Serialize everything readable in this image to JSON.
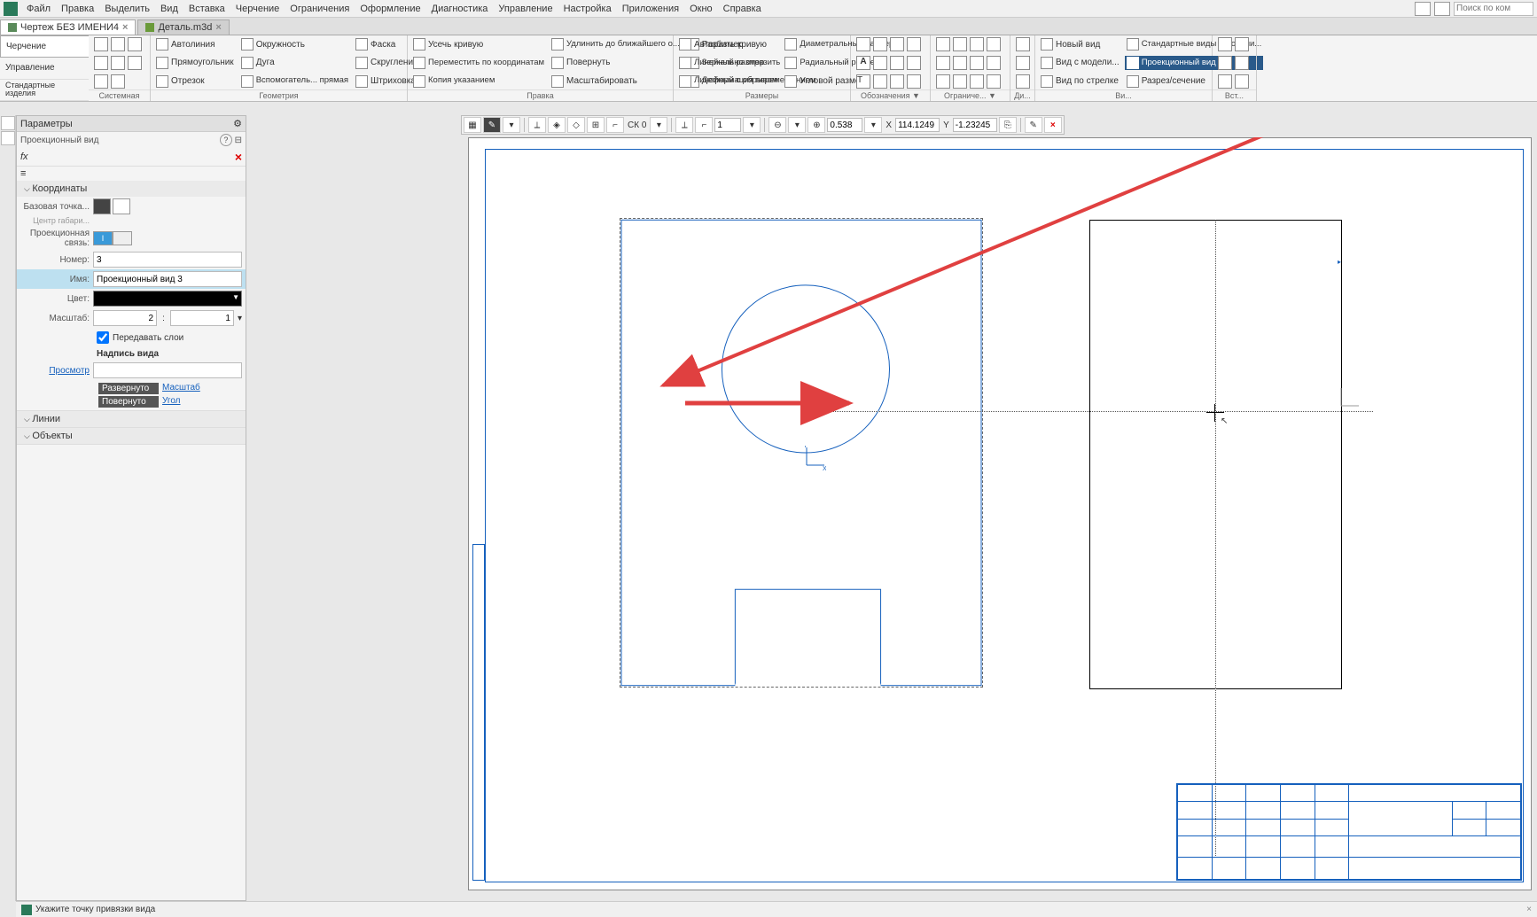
{
  "menu": [
    "Файл",
    "Правка",
    "Выделить",
    "Вид",
    "Вставка",
    "Черчение",
    "Ограничения",
    "Оформление",
    "Диагностика",
    "Управление",
    "Настройка",
    "Приложения",
    "Окно",
    "Справка"
  ],
  "search_placeholder": "Поиск по ком",
  "tabs": [
    {
      "label": "Чертеж БЕЗ ИМЕНИ4",
      "active": true
    },
    {
      "label": "Деталь.m3d",
      "active": false
    }
  ],
  "ribbon_left_tabs": [
    "Черчение",
    "Управление",
    "Стандартные изделия"
  ],
  "ribbon_groups": {
    "system": "Системная",
    "geometry": {
      "title": "Геометрия",
      "items": [
        "Автолиния",
        "Окружность",
        "Фаска",
        "Прямоугольник",
        "Дуга",
        "Скругление",
        "Отрезок",
        "Вспомогатель... прямая",
        "Штриховка"
      ]
    },
    "edit": {
      "title": "Правка",
      "items": [
        "Усечь кривую",
        "Удлинить до ближайшего о...",
        "Разбить кривую",
        "Переместить по координатам",
        "Повернуть",
        "Зеркально отразить",
        "Копия указанием",
        "Масштабировать",
        "Деформация перемещением"
      ]
    },
    "dims": {
      "title": "Размеры",
      "items": [
        "Авторазмер",
        "Диаметральный размер",
        "Линейный размер",
        "Радиальный размер",
        "Линейный с обрывом",
        "Угловой размер"
      ]
    },
    "annot": {
      "title": "Обозначения ▼"
    },
    "constraints": {
      "title": "Ограниче... ▼"
    },
    "diag": {
      "title": "Ди..."
    },
    "views": {
      "title": "Ви...",
      "items": [
        "Новый вид",
        "Стандартные виды с модели...",
        "Вид с модели...",
        "Проекционный вид",
        "Вид по стрелке",
        "Разрез/сечение"
      ]
    },
    "ins": {
      "title": "Вст..."
    }
  },
  "highlighted_button": "Проекционный вид",
  "drawing_toolbar": {
    "sk": "СК 0",
    "step": "1",
    "zoom": "0.538",
    "x_label": "X",
    "x": "114.1249",
    "y_label": "Y",
    "y": "-1.23245"
  },
  "panel": {
    "title": "Параметры",
    "subtitle": "Проекционный вид",
    "section_coords": "Координаты",
    "base_point_label": "Базовая точка...",
    "base_point_sub": "Центр габари...",
    "proj_link_label": "Проекционная связь:",
    "proj_link_on": "I",
    "number_label": "Номер:",
    "number": "3",
    "name_label": "Имя:",
    "name": "Проекционный вид 3",
    "color_label": "Цвет:",
    "scale_label": "Масштаб:",
    "scale_a": "2",
    "scale_b": "1",
    "layers_chk": "Передавать слои",
    "caption_header": "Надпись вида",
    "preview_label": "Просмотр",
    "grid_rows": [
      {
        "l": "Развернуто",
        "r": "Масштаб"
      },
      {
        "l": "Повернуто",
        "r": "Угол"
      }
    ],
    "section_lines": "Линии",
    "section_objects": "Объекты"
  },
  "status": "Укажите точку привязки вида",
  "coord_labels": {
    "x": "X",
    "y": "Y"
  }
}
